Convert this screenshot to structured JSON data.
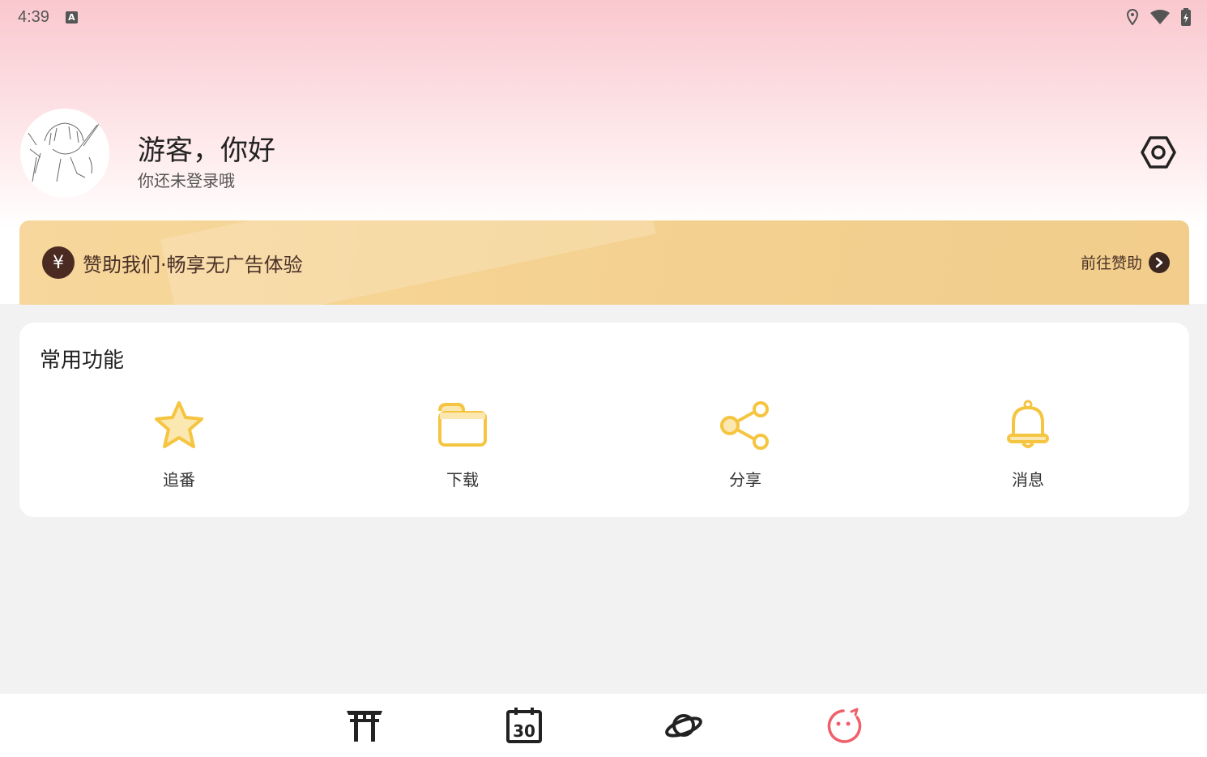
{
  "status_bar": {
    "time": "4:39",
    "notification_icon": "A"
  },
  "profile": {
    "greeting": "游客，你好",
    "subtitle": "你还未登录哦"
  },
  "sponsor": {
    "icon_char": "¥",
    "text": "赞助我们·畅享无广告体验",
    "link_label": "前往赞助"
  },
  "functions": {
    "title": "常用功能",
    "items": [
      {
        "label": "追番",
        "icon": "star-icon"
      },
      {
        "label": "下载",
        "icon": "folder-icon"
      },
      {
        "label": "分享",
        "icon": "share-icon"
      },
      {
        "label": "消息",
        "icon": "bell-icon"
      }
    ]
  },
  "bottom_nav": {
    "items": [
      {
        "icon": "torii-gate-icon",
        "active": false
      },
      {
        "icon": "calendar-icon",
        "calendar_day": "30",
        "active": false
      },
      {
        "icon": "planet-icon",
        "active": false
      },
      {
        "icon": "face-icon",
        "active": true
      }
    ]
  },
  "colors": {
    "accent_yellow": "#f5c542",
    "active_nav": "#f0606a",
    "sponsor_dark": "#4a2a21"
  }
}
